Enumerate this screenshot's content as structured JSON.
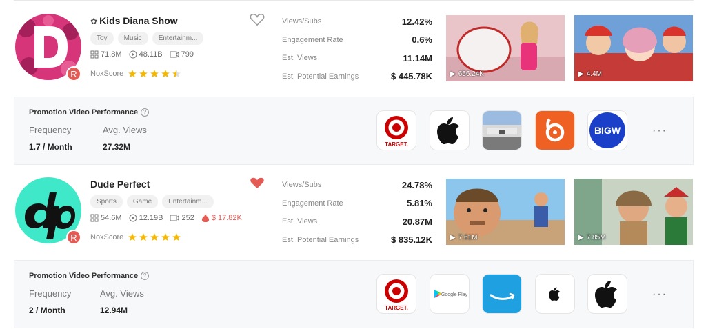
{
  "channels": [
    {
      "name": "Kids Diana Show",
      "tags": [
        "Toy",
        "Music",
        "Entertainm..."
      ],
      "subscribers": "71.8M",
      "views": "48.11B",
      "videos": "799",
      "badge": "R",
      "nox_label": "NoxScore",
      "nox_score": 4.5,
      "favorited": false,
      "metrics": [
        {
          "label": "Views/Subs",
          "value": "12.42%"
        },
        {
          "label": "Engagement Rate",
          "value": "0.6%"
        },
        {
          "label": "Est. Views",
          "value": "11.14M"
        },
        {
          "label": "Est. Potential Earnings",
          "value": "$ 445.78K"
        }
      ],
      "videos_thumbs": [
        {
          "views": "656.24K"
        },
        {
          "views": "4.4M"
        }
      ],
      "promo": {
        "title": "Promotion Video Performance",
        "frequency_label": "Frequency",
        "frequency": "1.7 / Month",
        "avg_views_label": "Avg. Views",
        "avg_views": "27.32M",
        "brands": [
          "target-logo",
          "apple-logo",
          "store-photo",
          "bitly-logo",
          "bigw-logo"
        ],
        "brand_texts": {
          "target": "TARGET.",
          "bigw": "BIGW"
        }
      }
    },
    {
      "name": "Dude Perfect",
      "tags": [
        "Sports",
        "Game",
        "Entertainm..."
      ],
      "subscribers": "54.6M",
      "views": "12.19B",
      "videos": "252",
      "cpm": "$ 17.82K",
      "badge": "R",
      "nox_label": "NoxScore",
      "nox_score": 5,
      "favorited": true,
      "metrics": [
        {
          "label": "Views/Subs",
          "value": "24.78%"
        },
        {
          "label": "Engagement Rate",
          "value": "5.81%"
        },
        {
          "label": "Est. Views",
          "value": "20.87M"
        },
        {
          "label": "Est. Potential Earnings",
          "value": "$ 835.12K"
        }
      ],
      "videos_thumbs": [
        {
          "views": "7.61M"
        },
        {
          "views": "7.85M"
        }
      ],
      "promo": {
        "title": "Promotion Video Performance",
        "frequency_label": "Frequency",
        "frequency": "2 / Month",
        "avg_views_label": "Avg. Views",
        "avg_views": "12.94M",
        "brands": [
          "target-logo",
          "google-play-logo",
          "amazon-logo",
          "apple-logo",
          "apple-logo"
        ],
        "brand_texts": {
          "target": "TARGET.",
          "google_play": "Google Play"
        }
      }
    }
  ],
  "colors": {
    "accent_red": "#e45a54",
    "star": "#f5b800",
    "diana_pink": "#c8246c",
    "dp_teal": "#3ee8c8"
  },
  "more_label": "···"
}
